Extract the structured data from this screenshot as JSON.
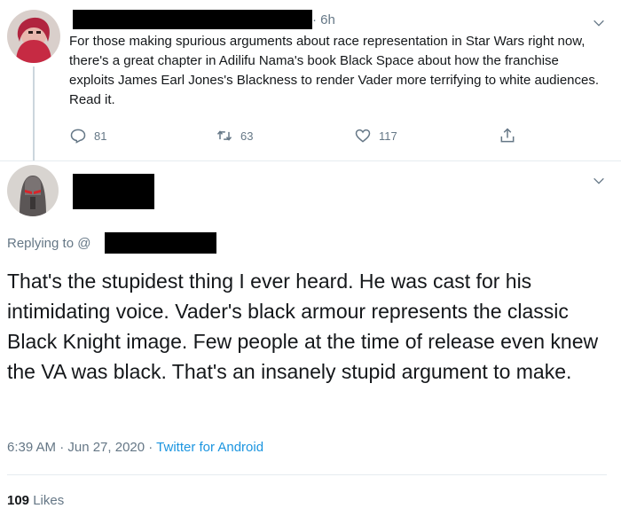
{
  "tweet1": {
    "time": "6h",
    "text": "For those making spurious arguments about race representation in Star Wars right now, there's a great chapter in Adilifu Nama's book Black Space about how the franchise exploits James Earl Jones's Blackness to render Vader more terrifying to white audiences. Read it.",
    "replies": "81",
    "retweets": "63",
    "likes": "117"
  },
  "tweet2": {
    "replying_to_label": "Replying to @",
    "text": "That's the stupidest thing I ever heard. He was cast for his intimidating voice. Vader's black armour represents the classic Black Knight image. Few people at the time of release even knew the VA was black. That's an insanely stupid argument to make.",
    "timestamp": "6:39 AM · Jun 27, 2020 · ",
    "source": "Twitter for Android",
    "likes_count": "109",
    "likes_label": "Likes"
  },
  "icons": {
    "reply": "reply-icon",
    "retweet": "retweet-icon",
    "like": "heart-icon",
    "share": "share-icon",
    "menu": "chevron-down-icon"
  },
  "colors": {
    "link": "#1b95e0",
    "muted": "#657786",
    "text": "#14171a",
    "divider": "#e6ecf0"
  }
}
